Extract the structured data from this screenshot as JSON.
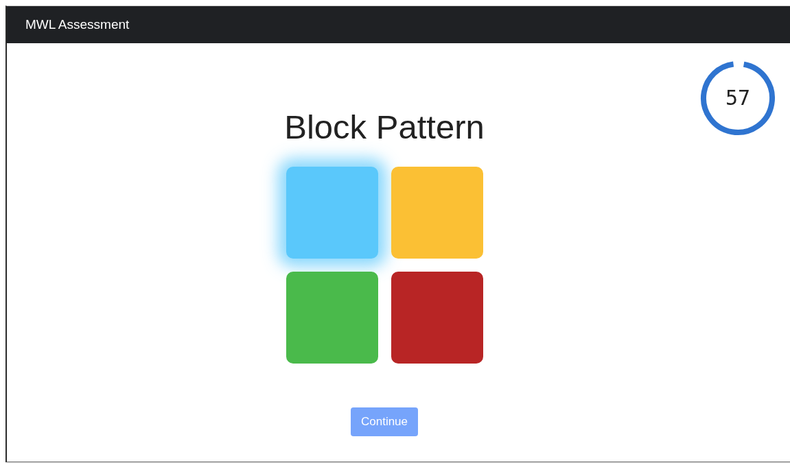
{
  "navbar": {
    "title": "MWL Assessment"
  },
  "timer": {
    "reading": "57",
    "level": 0.95
  },
  "heading": "Block Pattern",
  "blocks": [
    {
      "color": "#5ac8fb",
      "lit": true
    },
    {
      "color": "#fbc034",
      "lit": false
    },
    {
      "color": "#4aba4b",
      "lit": false
    },
    {
      "color": "#b82525",
      "lit": false
    }
  ],
  "continue_button": {
    "label": "Continue",
    "disabled": true
  }
}
